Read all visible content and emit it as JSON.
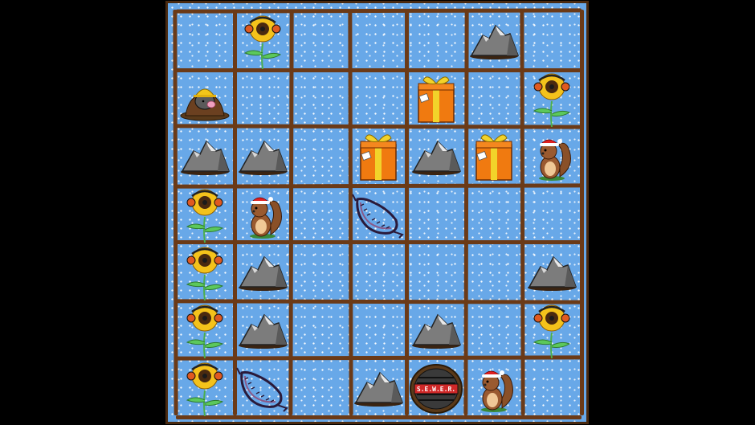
{
  "game": {
    "board_size": [
      7,
      7
    ],
    "tiles": [
      {
        "row": 0,
        "col": 1,
        "type": "sunflower"
      },
      {
        "row": 0,
        "col": 5,
        "type": "rock"
      },
      {
        "row": 1,
        "col": 0,
        "type": "mole"
      },
      {
        "row": 1,
        "col": 4,
        "type": "gift"
      },
      {
        "row": 1,
        "col": 6,
        "type": "sunflower"
      },
      {
        "row": 2,
        "col": 0,
        "type": "rock"
      },
      {
        "row": 2,
        "col": 1,
        "type": "rock"
      },
      {
        "row": 2,
        "col": 3,
        "type": "gift"
      },
      {
        "row": 2,
        "col": 4,
        "type": "rock"
      },
      {
        "row": 2,
        "col": 5,
        "type": "gift"
      },
      {
        "row": 2,
        "col": 6,
        "type": "squirrel"
      },
      {
        "row": 3,
        "col": 0,
        "type": "sunflower"
      },
      {
        "row": 3,
        "col": 1,
        "type": "squirrel"
      },
      {
        "row": 3,
        "col": 3,
        "type": "trap"
      },
      {
        "row": 4,
        "col": 0,
        "type": "sunflower"
      },
      {
        "row": 4,
        "col": 1,
        "type": "rock"
      },
      {
        "row": 4,
        "col": 6,
        "type": "rock"
      },
      {
        "row": 5,
        "col": 0,
        "type": "sunflower"
      },
      {
        "row": 5,
        "col": 1,
        "type": "rock"
      },
      {
        "row": 5,
        "col": 4,
        "type": "rock"
      },
      {
        "row": 5,
        "col": 6,
        "type": "sunflower"
      },
      {
        "row": 6,
        "col": 0,
        "type": "sunflower"
      },
      {
        "row": 6,
        "col": 1,
        "type": "trap"
      },
      {
        "row": 6,
        "col": 3,
        "type": "rock"
      },
      {
        "row": 6,
        "col": 4,
        "type": "sewer"
      },
      {
        "row": 6,
        "col": 5,
        "type": "squirrel"
      }
    ],
    "sewer_label": "S.E.W.E.R.",
    "colors": {
      "board": "#68a8e8",
      "grid": "#6b3a17",
      "background": "#000000"
    }
  }
}
